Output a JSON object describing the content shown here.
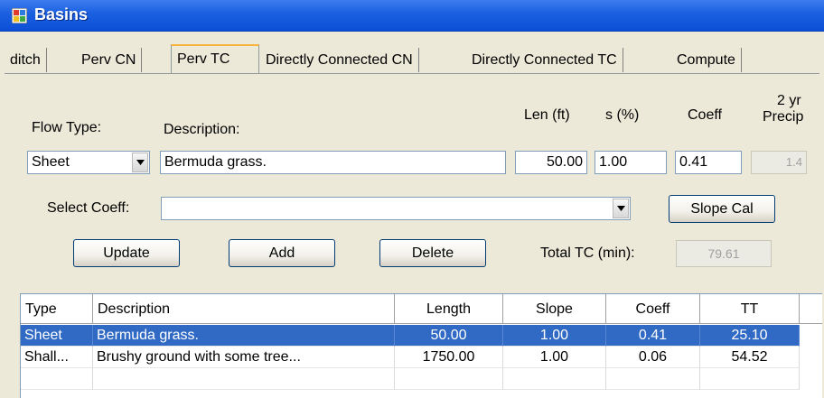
{
  "window": {
    "title": "Basins"
  },
  "tabs": [
    {
      "label": "ditch"
    },
    {
      "label": "Perv CN"
    },
    {
      "label": "Perv TC"
    },
    {
      "label": "Directly Connected CN"
    },
    {
      "label": "Directly Connected TC"
    },
    {
      "label": "Compute"
    }
  ],
  "active_tab": "Perv TC",
  "form": {
    "flow_type_label": "Flow Type:",
    "flow_type_value": "Sheet",
    "description_label": "Description:",
    "description_value": "Bermuda grass.",
    "len_label": "Len (ft)",
    "len_value": "50.00",
    "s_label": "s (%)",
    "s_value": "1.00",
    "coeff_label": "Coeff",
    "coeff_value": "0.41",
    "precip_label_1": "2 yr",
    "precip_label_2": "Precip",
    "precip_value": "1.4",
    "select_coeff_label": "Select Coeff:",
    "select_coeff_value": "",
    "slope_cal_label": "Slope Cal",
    "update_label": "Update",
    "add_label": "Add",
    "delete_label": "Delete",
    "total_tc_label": "Total TC (min):",
    "total_tc_value": "79.61"
  },
  "grid": {
    "columns": [
      "Type",
      "Description",
      "Length",
      "Slope",
      "Coeff",
      "TT"
    ],
    "rows": [
      {
        "type": "Sheet",
        "description": "Bermuda grass.",
        "length": "50.00",
        "slope": "1.00",
        "coeff": "0.41",
        "tt": "25.10",
        "selected": true
      },
      {
        "type": "Shall...",
        "description": "Brushy ground with some tree...",
        "length": "1750.00",
        "slope": "1.00",
        "coeff": "0.06",
        "tt": "54.52",
        "selected": false
      }
    ]
  },
  "colors": {
    "titlebar": "#0c4fd6",
    "selection": "#316ac5",
    "tab_highlight": "#f8b43a"
  },
  "icons": {
    "app": "window-app-icon",
    "dropdown": "chevron-down-icon"
  }
}
